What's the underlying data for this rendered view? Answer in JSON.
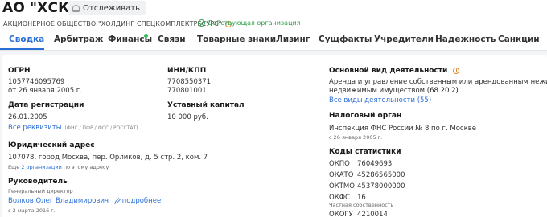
{
  "header": {
    "title": "АО \"ХСКР\"",
    "track_label": "Отслеживать",
    "full_name": "АКЦИОНЕРНОЕ ОБЩЕСТВО \"ХОЛДИНГ СПЕЦКОМПЛЕКТРЕСУРС\"",
    "status": "Действующая организация"
  },
  "tabs": [
    {
      "label": "Сводка"
    },
    {
      "label": "Арбитраж"
    },
    {
      "label": "Финансы"
    },
    {
      "label": "Связи"
    },
    {
      "label": "Товарные знаки"
    },
    {
      "label": "Лизинг"
    },
    {
      "label": "Сущфакты"
    },
    {
      "label": "Учредители"
    },
    {
      "label": "Надежность"
    },
    {
      "label": "Санкции"
    }
  ],
  "col1": {
    "ogrn_label": "ОГРН",
    "ogrn_value": "1057746095769",
    "ogrn_date": "от 26 января 2005 г.",
    "reg_label": "Дата регистрации",
    "reg_value": "26.01.2005",
    "all_details": "Все реквизиты",
    "details_tag": "(ФНС / ПФР / ФСС / РОССТАТ)",
    "address_label": "Юридический адрес",
    "address_value": "107078, город Москва, пер. Орликов, д. 5 стр. 2, ком. 7",
    "address_more_prefix": "Еще",
    "address_more_link": "2 организации",
    "address_more_suffix": "по этому адресу",
    "head_label": "Руководитель",
    "head_role": "Генеральный директор",
    "head_name": "Волков Олег Владимирович",
    "head_more": "подробнее",
    "head_date": "с 2 марта 2016 г."
  },
  "col2": {
    "inn_label": "ИНН/КПП",
    "inn_value": "7708550371",
    "kpp_value": "770801001",
    "capital_label": "Уставный капитал",
    "capital_value": "10 000 руб."
  },
  "col3": {
    "activity_label": "Основной вид деятельности",
    "activity_line1": "Аренда и управление собственным или арендованным нежилым",
    "activity_line2": "недвижимым имуществом",
    "activity_code": "(68.20.2)",
    "activity_all": "Все виды деятельности (55)",
    "tax_label": "Налоговый орган",
    "tax_value": "Инспекция ФНС России № 8 по г. Москве",
    "tax_date": "с 26 января 2005 г.",
    "codes_label": "Коды статистики",
    "codes": [
      {
        "name": "ОКПО",
        "value": "76049693"
      },
      {
        "name": "ОКАТО",
        "value": "45286565000"
      },
      {
        "name": "ОКТМО",
        "value": "45378000000"
      },
      {
        "name": "ОКФС",
        "value": "16"
      },
      {
        "name": "ОКОГУ",
        "value": "4210014"
      }
    ],
    "okfs_note": "Частная собственность"
  }
}
